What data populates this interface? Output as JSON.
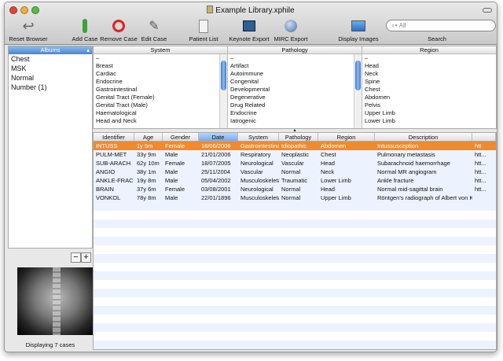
{
  "window": {
    "title": "Example Library.xphile"
  },
  "toolbar": {
    "reset": "Reset Browser",
    "add": "Add Case",
    "remove": "Remove Case",
    "edit": "Edit Case",
    "patients": "Patient List",
    "keynote": "Keynote Export",
    "mirc": "MIRC Export",
    "display": "Display Images",
    "search_label": "Search",
    "search_placeholder": "All"
  },
  "sidebar": {
    "header": "Albums",
    "items": [
      "Chest",
      "MSK",
      "Normal",
      "Number (1)"
    ],
    "status": "Displaying 7 cases"
  },
  "browser": {
    "system": {
      "header": "System",
      "items": [
        "–",
        "Breast",
        "Cardiac",
        "Endocrine",
        "Gastrointestinal",
        "Genital Tract (Female)",
        "Genital Tract (Male)",
        "Haematological",
        "Head and Neck"
      ]
    },
    "pathology": {
      "header": "Pathology",
      "items": [
        "–",
        "Artifact",
        "Autoimmune",
        "Congenital",
        "Developmental",
        "Degenerative",
        "Drug Related",
        "Endocrine",
        "Iatrogenic"
      ]
    },
    "region": {
      "header": "Region",
      "items": [
        "–",
        "Head",
        "Neck",
        "Spine",
        "Chest",
        "Abdomen",
        "Pelvis",
        "Upper Limb",
        "Lower Limb"
      ]
    }
  },
  "table": {
    "columns": [
      "Identifier",
      "Age",
      "Gender",
      "Date",
      "System",
      "Pathology",
      "Region",
      "Description",
      ""
    ],
    "sort_column": "Date",
    "rows": [
      [
        "INTUSS",
        "1y 5m",
        "Female",
        "18/06/2006",
        "Gastrointestinal",
        "Idiopathic",
        "Abdomen",
        "Intussusception",
        "htt"
      ],
      [
        "PULM-MET",
        "33y 9m",
        "Male",
        "21/01/2006",
        "Respiratory",
        "Neoplastic",
        "Chest",
        "Pulmonary metastasis",
        "htt..."
      ],
      [
        "SUB-ARACH",
        "62y 10m",
        "Female",
        "18/07/2005",
        "Neurological",
        "Vascular",
        "Head",
        "Subarachnoid haemorrhage",
        "htt..."
      ],
      [
        "ANGIO",
        "38y 1m",
        "Male",
        "25/11/2004",
        "Vascular",
        "Normal",
        "Neck",
        "Normal MR angiogram",
        "htt..."
      ],
      [
        "ANKLE-FRAC",
        "19y 8m",
        "Male",
        "05/04/2002",
        "Musculoskeletal",
        "Traumatic",
        "Lower Limb",
        "Ankle fracture",
        "htt..."
      ],
      [
        "BRAIN",
        "37y 6m",
        "Female",
        "03/08/2001",
        "Neurological",
        "Normal",
        "Head",
        "Normal mid-sagittal brain",
        "htt..."
      ],
      [
        "VONKOL",
        "78y 8m",
        "Male",
        "22/01/1896",
        "Musculoskeletal",
        "Normal",
        "Upper Limb",
        "Röntgen's radiograph of Albert von Köll...",
        ""
      ]
    ]
  },
  "colors": {
    "selection": "#f08a2c",
    "accent": "#4a86d4"
  }
}
